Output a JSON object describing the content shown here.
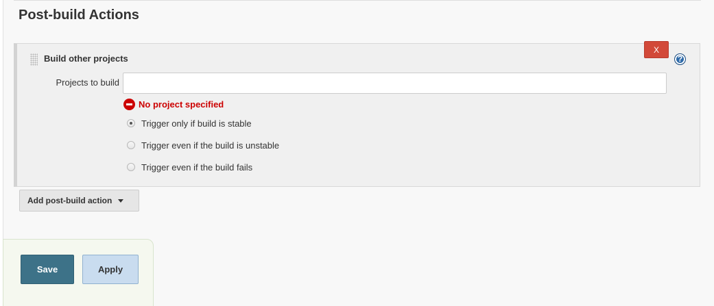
{
  "section": {
    "title": "Post-build Actions"
  },
  "step": {
    "title": "Build other projects",
    "delete_label": "X",
    "help_label": "?",
    "projects_field": {
      "label": "Projects to build",
      "value": "",
      "placeholder": ""
    },
    "error": "No project specified",
    "trigger_options": [
      {
        "label": "Trigger only if build is stable",
        "checked": true
      },
      {
        "label": "Trigger even if the build is unstable",
        "checked": false
      },
      {
        "label": "Trigger even if the build fails",
        "checked": false
      }
    ]
  },
  "add_action": {
    "label": "Add post-build action"
  },
  "footer": {
    "save_label": "Save",
    "apply_label": "Apply"
  },
  "colors": {
    "delete_button": "#d24939",
    "save_button": "#3d7288",
    "apply_button": "#c9dcef",
    "error": "#cc0000",
    "help_icon": "#2e6aa9"
  },
  "icons": {
    "drag": "drag-handle-icon",
    "help": "help-icon",
    "error": "error-icon",
    "dropdown": "caret-down-icon"
  }
}
